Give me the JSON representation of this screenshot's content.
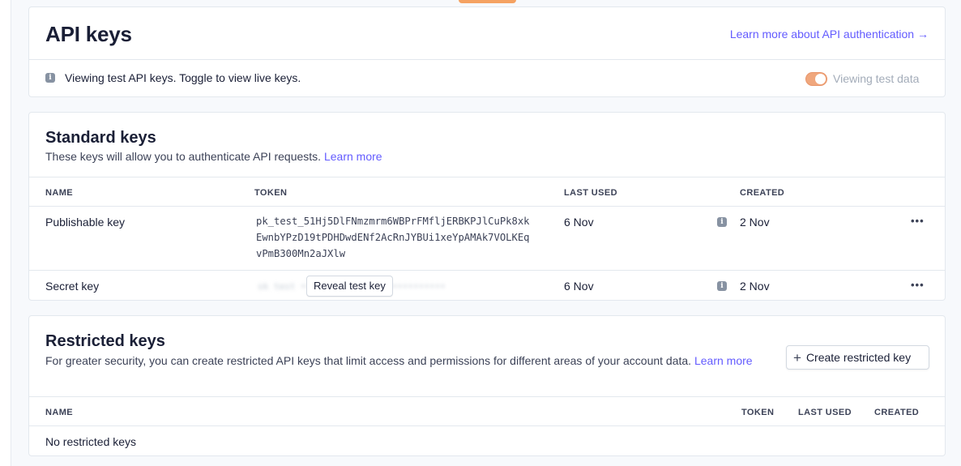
{
  "header": {
    "title": "API keys",
    "learn_link": "Learn more about API authentication →"
  },
  "test_banner": {
    "message": "Viewing test API keys. Toggle to view live keys.",
    "toggle_label": "Viewing test data",
    "toggle_on": true
  },
  "standard": {
    "title": "Standard keys",
    "description": "These keys will allow you to authenticate API requests.",
    "learn_more": "Learn more",
    "columns": [
      "NAME",
      "TOKEN",
      "LAST USED",
      "CREATED"
    ],
    "rows": [
      {
        "name": "Publishable key",
        "token": "pk_test_51Hj5DlFNmzmrm6WBPrFMfljERBKPJlCuPk8xkEwnbYPzD19tPDHDwdENf2AcRnJYBUi1xeYpAMAk7VOLKEqvPmB300Mn2aJXlw",
        "last_used": "6 Nov",
        "created": "2 Nov"
      },
      {
        "name": "Secret key",
        "reveal_label": "Reveal test key",
        "last_used": "6 Nov",
        "created": "2 Nov"
      }
    ]
  },
  "restricted": {
    "title": "Restricted keys",
    "description": "For greater security, you can create restricted API keys that limit access and permissions for different areas of your account data.",
    "learn_more": "Learn more",
    "create_button": "Create restricted key",
    "columns": [
      "NAME",
      "TOKEN",
      "LAST USED",
      "CREATED"
    ],
    "empty": "No restricted keys"
  },
  "icons": {
    "info": "info-icon",
    "more": "more-horizontal-icon",
    "plus": "plus-icon"
  },
  "colors": {
    "accent": "#635bff",
    "test_orange": "#f5a262",
    "border": "#e3e8ee"
  }
}
